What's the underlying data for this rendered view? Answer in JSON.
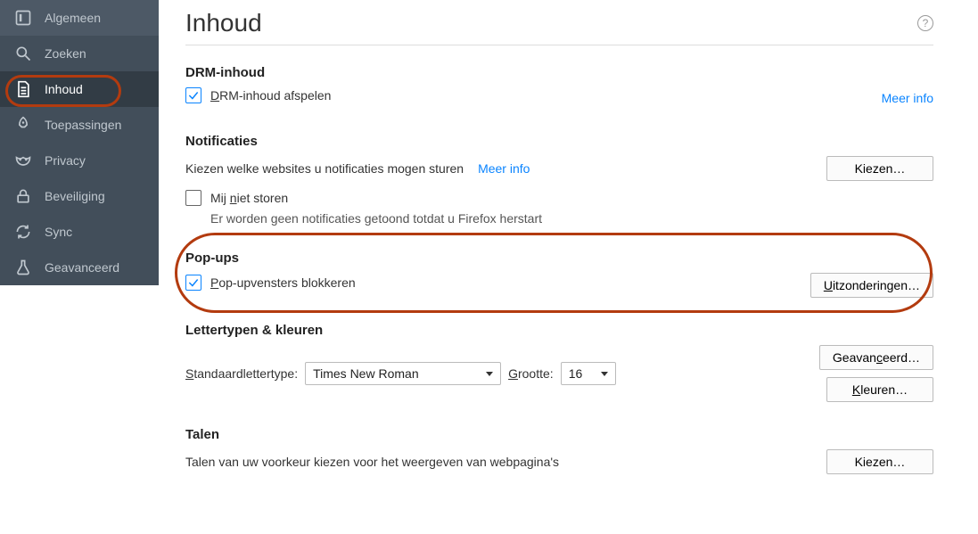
{
  "sidebar": {
    "items": [
      {
        "label": "Algemeen"
      },
      {
        "label": "Zoeken"
      },
      {
        "label": "Inhoud"
      },
      {
        "label": "Toepassingen"
      },
      {
        "label": "Privacy"
      },
      {
        "label": "Beveiliging"
      },
      {
        "label": "Sync"
      },
      {
        "label": "Geavanceerd"
      }
    ]
  },
  "page": {
    "title": "Inhoud",
    "helpTooltip": "?"
  },
  "drm": {
    "title": "DRM-inhoud",
    "checkboxLabel": "DRM-inhoud afspelen",
    "meerInfo": "Meer info"
  },
  "notifications": {
    "title": "Notificaties",
    "desc": "Kiezen welke websites u notificaties mogen sturen",
    "meerInfo": "Meer info",
    "kiezenBtn": "Kiezen…",
    "dndLabel": "Mij niet storen",
    "dndNote": "Er worden geen notificaties getoond totdat u Firefox herstart"
  },
  "popups": {
    "title": "Pop-ups",
    "checkboxLabel": "Pop-upvensters blokkeren",
    "exceptionsBtn": "Uitzonderingen…"
  },
  "fonts": {
    "title": "Lettertypen & kleuren",
    "stdLabel": "Standaardlettertype:",
    "fontValue": "Times New Roman",
    "sizeLabel": "Grootte:",
    "sizeValue": "16",
    "advBtn": "Geavanceerd…",
    "colorsBtn": "Kleuren…"
  },
  "languages": {
    "title": "Talen",
    "desc": "Talen van uw voorkeur kiezen voor het weergeven van webpagina's",
    "kiezenBtn": "Kiezen…"
  }
}
